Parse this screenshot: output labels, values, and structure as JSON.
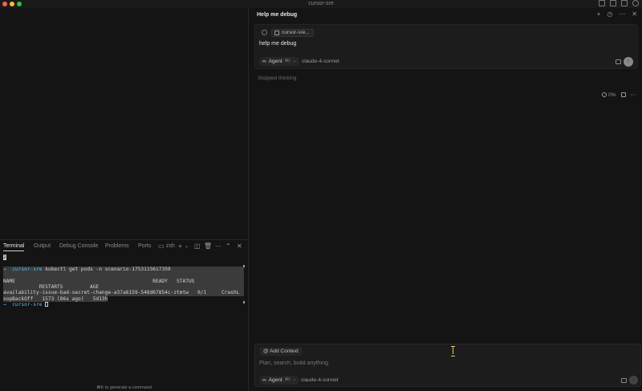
{
  "window": {
    "title": "cursor-sre"
  },
  "panel": {
    "tabs": [
      "Terminal",
      "Output",
      "Debug Console",
      "Problems",
      "Ports"
    ],
    "shell_label": "zsh",
    "hint": "⌘K to generate a command"
  },
  "terminal": {
    "top_marker": "2",
    "prompt_arrow": "→",
    "prompt_dir": "cursor-sre",
    "command": "kubectl get pods -n scenario-1753115617359",
    "header_line1": "NAME                                              READY   STATUS",
    "header_line2": "            RESTARTS         AGE",
    "row_line1": "availability-issue-bad-secret-change-a37a6159-548d67854c-ztmtw   0/1     CrashL",
    "row_line2": "oopBackOff   1573 (86s ago)   5d13h"
  },
  "chat": {
    "title": "Help me debug",
    "context_chip": "cursor-sre...",
    "message": "help me debug",
    "mode": "Agent",
    "mode_shortcut": "⌘I",
    "model": "claude-4-sonnet",
    "status": "Stopped thinking",
    "progress": "0%",
    "add_context": "Add Context",
    "input_placeholder": "Plan, search, build anything"
  }
}
